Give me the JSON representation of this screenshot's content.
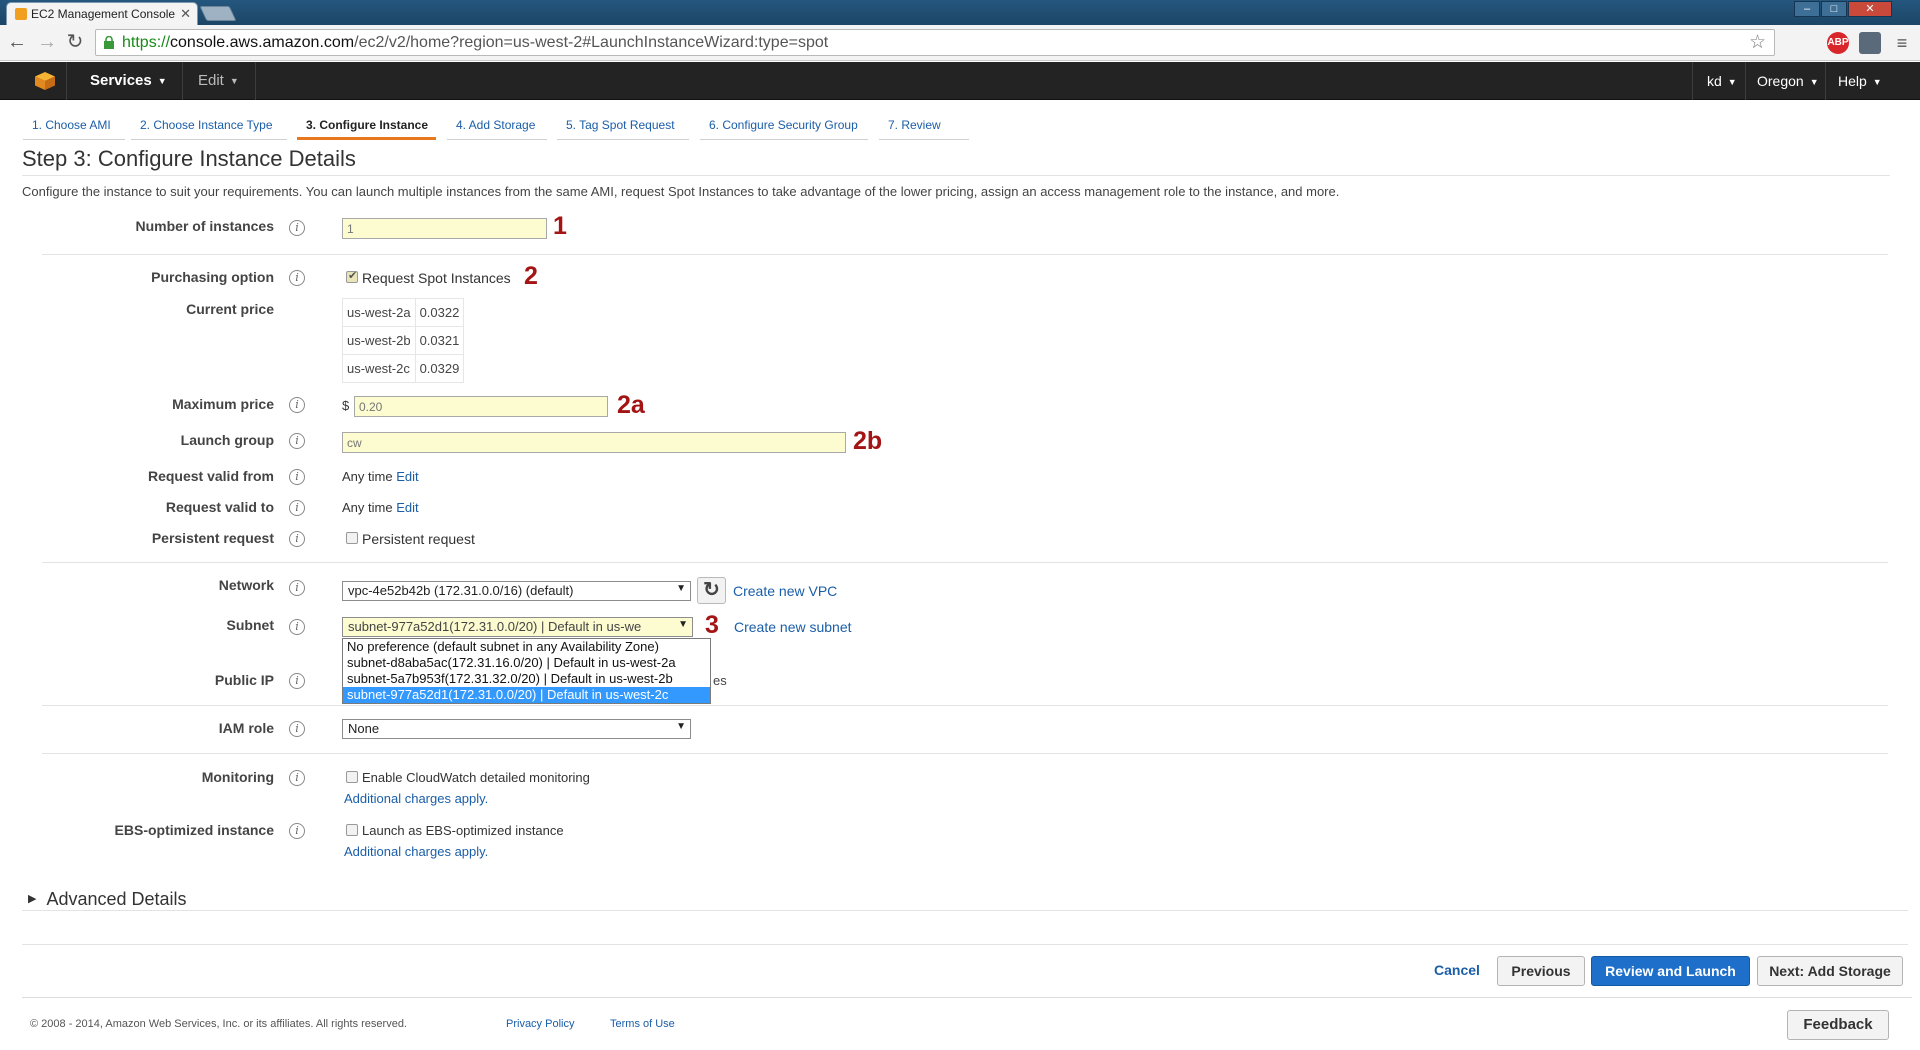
{
  "browser": {
    "tab_title": "EC2 Management Console",
    "url_scheme": "https://",
    "url_host": "console.aws.amazon.com",
    "url_path": "/ec2/v2/home?region=us-west-2#LaunchInstanceWizard:type=spot",
    "abp_label": "ABP"
  },
  "aws_header": {
    "services": "Services",
    "edit": "Edit",
    "user": "kd",
    "region": "Oregon",
    "help": "Help"
  },
  "wizard": {
    "steps": [
      "1. Choose AMI",
      "2. Choose Instance Type",
      "3. Configure Instance",
      "4. Add Storage",
      "5. Tag Spot Request",
      "6. Configure Security Group",
      "7. Review"
    ],
    "active_step": 3
  },
  "page": {
    "title": "Step 3: Configure Instance Details",
    "description": "Configure the instance to suit your requirements. You can launch multiple instances from the same AMI, request Spot Instances to take advantage of the lower pricing, assign an access management role to the instance, and more."
  },
  "form": {
    "number_of_instances": {
      "label": "Number of instances",
      "value": "1",
      "annotation": "1"
    },
    "purchasing_option": {
      "label": "Purchasing option",
      "checkbox_label": "Request Spot Instances",
      "checked": true,
      "annotation": "2"
    },
    "current_price": {
      "label": "Current price",
      "rows": [
        {
          "zone": "us-west-2a",
          "price": "0.0322"
        },
        {
          "zone": "us-west-2b",
          "price": "0.0321"
        },
        {
          "zone": "us-west-2c",
          "price": "0.0329"
        }
      ]
    },
    "maximum_price": {
      "label": "Maximum price",
      "currency": "$",
      "value": "0.20",
      "annotation": "2a"
    },
    "launch_group": {
      "label": "Launch group",
      "value": "cw",
      "annotation": "2b"
    },
    "request_valid_from": {
      "label": "Request valid from",
      "value": "Any time",
      "edit": "Edit"
    },
    "request_valid_to": {
      "label": "Request valid to",
      "value": "Any time",
      "edit": "Edit"
    },
    "persistent_request": {
      "label": "Persistent request",
      "checkbox_label": "Persistent request",
      "checked": false
    },
    "network": {
      "label": "Network",
      "value": "vpc-4e52b42b (172.31.0.0/16) (default)",
      "create_link": "Create new VPC"
    },
    "subnet": {
      "label": "Subnet",
      "value": "subnet-977a52d1(172.31.0.0/20) | Default in us-we",
      "create_link": "Create new subnet",
      "annotation": "3",
      "options": [
        "No preference (default subnet in any Availability Zone)",
        "subnet-d8aba5ac(172.31.16.0/20) | Default in us-west-2a",
        "subnet-5a7b953f(172.31.32.0/20) | Default in us-west-2b",
        "subnet-977a52d1(172.31.0.0/20) | Default in us-west-2c"
      ],
      "selected_index": 3
    },
    "public_ip": {
      "label": "Public IP",
      "partial_text": "es"
    },
    "iam_role": {
      "label": "IAM role",
      "value": "None"
    },
    "monitoring": {
      "label": "Monitoring",
      "checkbox_label": "Enable CloudWatch detailed monitoring",
      "checked": false,
      "note": "Additional charges apply."
    },
    "ebs_optimized": {
      "label": "EBS-optimized instance",
      "checkbox_label": "Launch as EBS-optimized instance",
      "checked": false,
      "note": "Additional charges apply."
    }
  },
  "advanced": {
    "label": "Advanced Details"
  },
  "actions": {
    "cancel": "Cancel",
    "previous": "Previous",
    "review": "Review and Launch",
    "next": "Next: Add Storage"
  },
  "footer": {
    "copyright": "© 2008 - 2014, Amazon Web Services, Inc. or its affiliates. All rights reserved.",
    "privacy": "Privacy Policy",
    "terms": "Terms of Use",
    "feedback": "Feedback"
  },
  "colors": {
    "annotation": "#a31515",
    "accent_orange": "#e8781e",
    "link_blue": "#1a5ea8",
    "primary_button": "#1d6fc9",
    "input_yellow": "#fdfbd0"
  }
}
